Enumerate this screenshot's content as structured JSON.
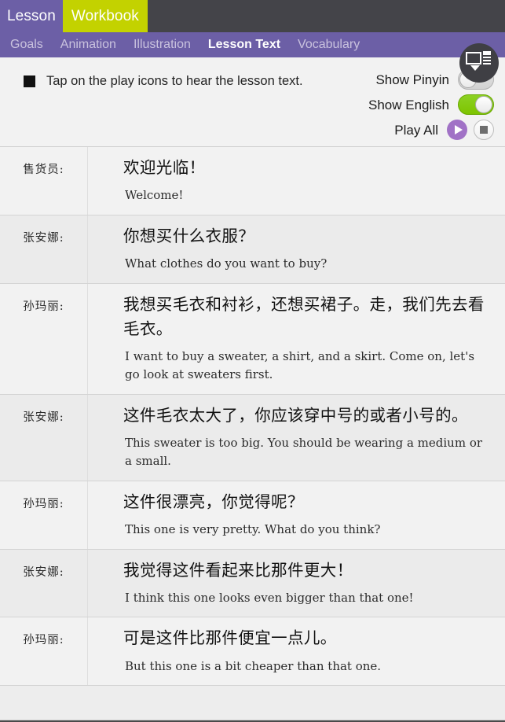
{
  "topbar": {
    "tabs": [
      {
        "label": "Lesson",
        "active": false
      },
      {
        "label": "Workbook",
        "active": true
      }
    ],
    "corner_icon": "screen-layout-icon"
  },
  "navbar": {
    "items": [
      {
        "label": "Goals",
        "active": false
      },
      {
        "label": "Animation",
        "active": false
      },
      {
        "label": "Illustration",
        "active": false
      },
      {
        "label": "Lesson Text",
        "active": true
      },
      {
        "label": "Vocabulary",
        "active": false
      }
    ]
  },
  "controls": {
    "hint": "Tap on the play icons to hear the lesson text.",
    "show_pinyin_label": "Show Pinyin",
    "show_pinyin_state": "off",
    "show_english_label": "Show English",
    "show_english_state": "on",
    "play_all_label": "Play All",
    "play_icon": "play-icon",
    "stop_icon": "stop-icon"
  },
  "colors": {
    "accent_purple": "#6c5fa6",
    "workbook_yellow": "#c3d200",
    "toggle_on_green": "#7ec400",
    "play_purple": "#a172c6",
    "topbar_dark": "#444449"
  },
  "dialogue": [
    {
      "speaker": "售货员:",
      "chinese": "欢迎光临！",
      "english": "Welcome!"
    },
    {
      "speaker": "张安娜:",
      "chinese": "你想买什么衣服？",
      "english": "What clothes do you want to buy?"
    },
    {
      "speaker": "孙玛丽:",
      "chinese": "我想买毛衣和衬衫，还想买裙子。走，我们先去看毛衣。",
      "english": "I want to buy a sweater, a shirt, and a skirt. Come on, let's go look at sweaters first."
    },
    {
      "speaker": "张安娜:",
      "chinese": "这件毛衣太大了，你应该穿中号的或者小号的。",
      "english": "This sweater is too big. You should be wearing a medium or a small."
    },
    {
      "speaker": "孙玛丽:",
      "chinese": "这件很漂亮，你觉得呢？",
      "english": "This one is very pretty. What do you think?"
    },
    {
      "speaker": "张安娜:",
      "chinese": "我觉得这件看起来比那件更大！",
      "english": "I think this one looks even bigger than that one!"
    },
    {
      "speaker": "孙玛丽:",
      "chinese": "可是这件比那件便宜一点儿。",
      "english": "But this one is a bit cheaper than that one."
    }
  ]
}
